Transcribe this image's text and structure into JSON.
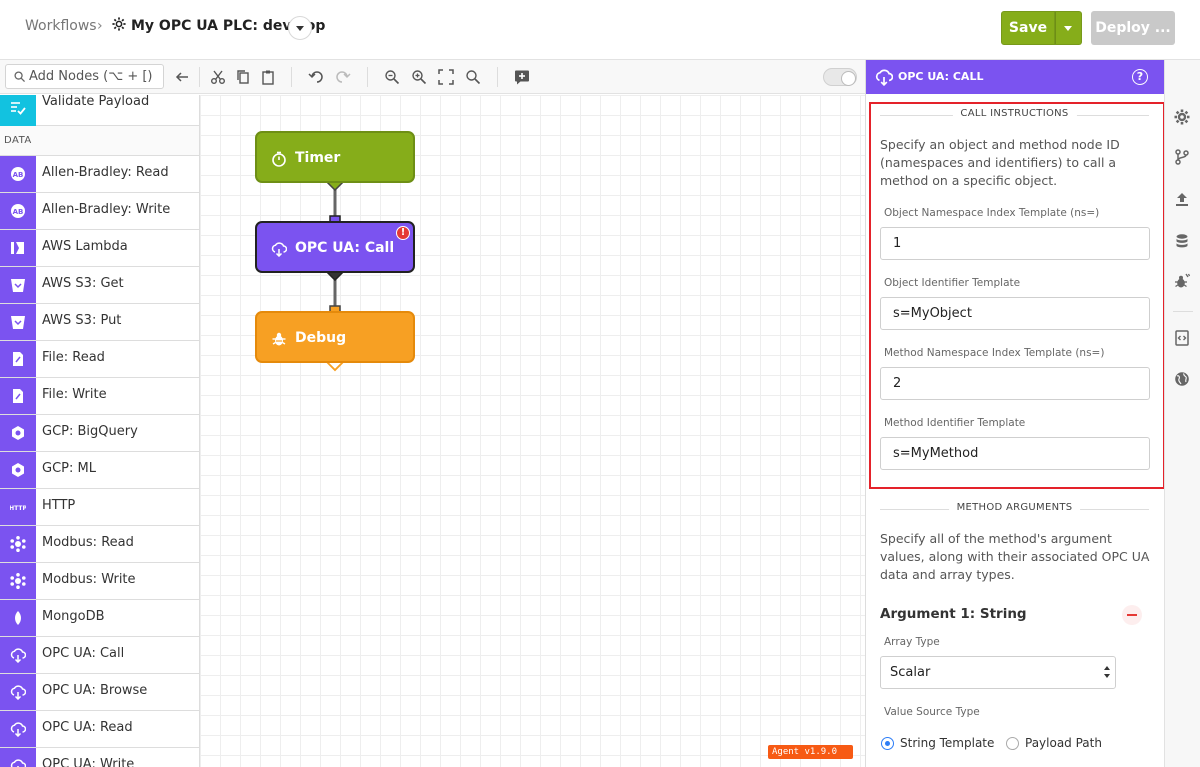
{
  "header": {
    "breadcrumb_root": "Workflows",
    "breadcrumb_sep": "›",
    "workflow_title": "My OPC UA PLC: develop",
    "save_label": "Save",
    "deploy_label": "Deploy ..."
  },
  "toolbar": {
    "search_placeholder": "Add Nodes (⌥ + [)",
    "tools": [
      "back-arrow-icon",
      "cut-icon",
      "copy-icon",
      "paste-icon",
      "undo-icon",
      "redo-icon",
      "zoom-out-icon",
      "zoom-in-icon",
      "fit-view-icon",
      "search-icon",
      "add-comment-icon"
    ]
  },
  "palette": {
    "top_item": "Validate Payload",
    "section": "DATA",
    "items": [
      "Allen-Bradley: Read",
      "Allen-Bradley: Write",
      "AWS Lambda",
      "AWS S3: Get",
      "AWS S3: Put",
      "File: Read",
      "File: Write",
      "GCP: BigQuery",
      "GCP: ML",
      "HTTP",
      "Modbus: Read",
      "Modbus: Write",
      "MongoDB",
      "OPC UA: Call",
      "OPC UA: Browse",
      "OPC UA: Read",
      "OPC UA: Write"
    ]
  },
  "canvas": {
    "nodes": {
      "timer": "Timer",
      "opc_call": "OPC UA: Call",
      "debug": "Debug"
    },
    "error_badge": "!",
    "agent_badge": "Agent v1.9.0"
  },
  "panel": {
    "title": "OPC UA: CALL",
    "help": "?",
    "call_section": "CALL INSTRUCTIONS",
    "call_desc": "Specify an object and method node ID (namespaces and identifiers) to call a method on a specific object.",
    "fields": [
      {
        "label": "Object Namespace Index Template (ns=)",
        "value": "1"
      },
      {
        "label": "Object Identifier Template",
        "value": "s=MyObject"
      },
      {
        "label": "Method Namespace Index Template (ns=)",
        "value": "2"
      },
      {
        "label": "Method Identifier Template",
        "value": "s=MyMethod"
      }
    ],
    "args_section": "METHOD ARGUMENTS",
    "args_desc": "Specify all of the method's argument values, along with their associated OPC UA data and array types.",
    "argument_title": "Argument 1: String",
    "array_type_label": "Array Type",
    "array_type_value": "Scalar",
    "value_source_label": "Value Source Type",
    "value_source_options": [
      "String Template",
      "Payload Path"
    ],
    "value_source_selected": "String Template"
  },
  "colors": {
    "accent_purple": "#7b53f0",
    "save_green": "#86ad1a",
    "debug_orange": "#f7a023",
    "highlight_red": "#e4222a"
  }
}
